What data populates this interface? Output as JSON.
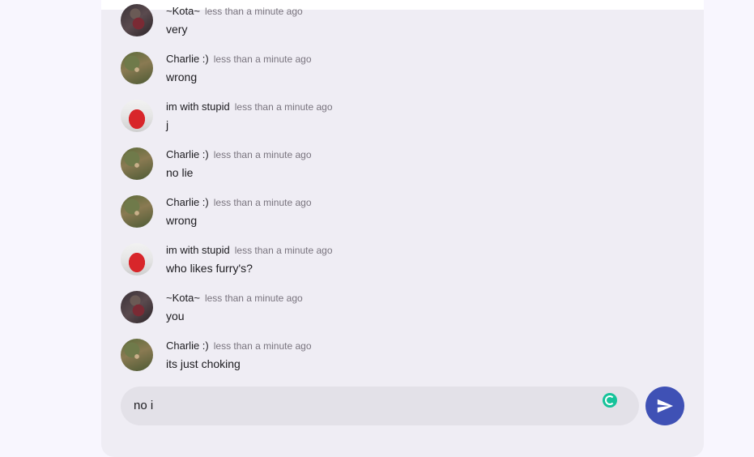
{
  "messages": [
    {
      "user": "~Kota~",
      "time": "less than a minute ago",
      "text": "very",
      "avatar": "kota"
    },
    {
      "user": "Charlie :)",
      "time": "less than a minute ago",
      "text": "wrong",
      "avatar": "charlie"
    },
    {
      "user": "im with stupid",
      "time": "less than a minute ago",
      "text": "j",
      "avatar": "stupid"
    },
    {
      "user": "Charlie :)",
      "time": "less than a minute ago",
      "text": "no lie",
      "avatar": "charlie"
    },
    {
      "user": "Charlie :)",
      "time": "less than a minute ago",
      "text": "wrong",
      "avatar": "charlie"
    },
    {
      "user": "im with stupid",
      "time": "less than a minute ago",
      "text": "who likes furry's?",
      "avatar": "stupid"
    },
    {
      "user": "~Kota~",
      "time": "less than a minute ago",
      "text": "you",
      "avatar": "kota"
    },
    {
      "user": "Charlie :)",
      "time": "less than a minute ago",
      "text": "its just choking",
      "avatar": "charlie"
    }
  ],
  "composer": {
    "value": "no i",
    "grammar_icon": "grammarly-icon",
    "send_icon": "send-icon",
    "send_color": "#3f51b5"
  }
}
